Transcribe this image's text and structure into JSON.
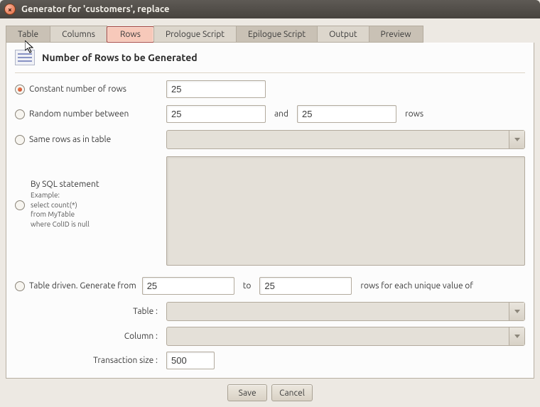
{
  "window": {
    "title": "Generator for 'customers', replace",
    "close_icon": "×"
  },
  "tabs": {
    "table": "Table",
    "columns": "Columns",
    "rows": "Rows",
    "prologue": "Prologue Script",
    "epilogue": "Epilogue Script",
    "output": "Output",
    "preview": "Preview"
  },
  "section": {
    "heading": "Number of Rows to be Generated"
  },
  "options": {
    "constant": {
      "label": "Constant number of rows",
      "value": "25"
    },
    "random": {
      "label": "Random number between",
      "from": "25",
      "and": "and",
      "to": "25",
      "suffix": "rows"
    },
    "same_table": {
      "label": "Same rows as in table"
    },
    "sql": {
      "title": "By SQL statement",
      "example_label": "Example:",
      "line1": "select count(*)",
      "line2": "from MyTable",
      "line3": "where ColID is null"
    },
    "table_driven": {
      "label": "Table driven. Generate from",
      "from": "25",
      "to_word": "to",
      "to": "25",
      "suffix": "rows for each unique value of"
    }
  },
  "fields": {
    "table_label": "Table :",
    "column_label": "Column :",
    "txn_label": "Transaction size :",
    "txn_value": "500"
  },
  "footer": {
    "save": "Save",
    "cancel": "Cancel"
  }
}
